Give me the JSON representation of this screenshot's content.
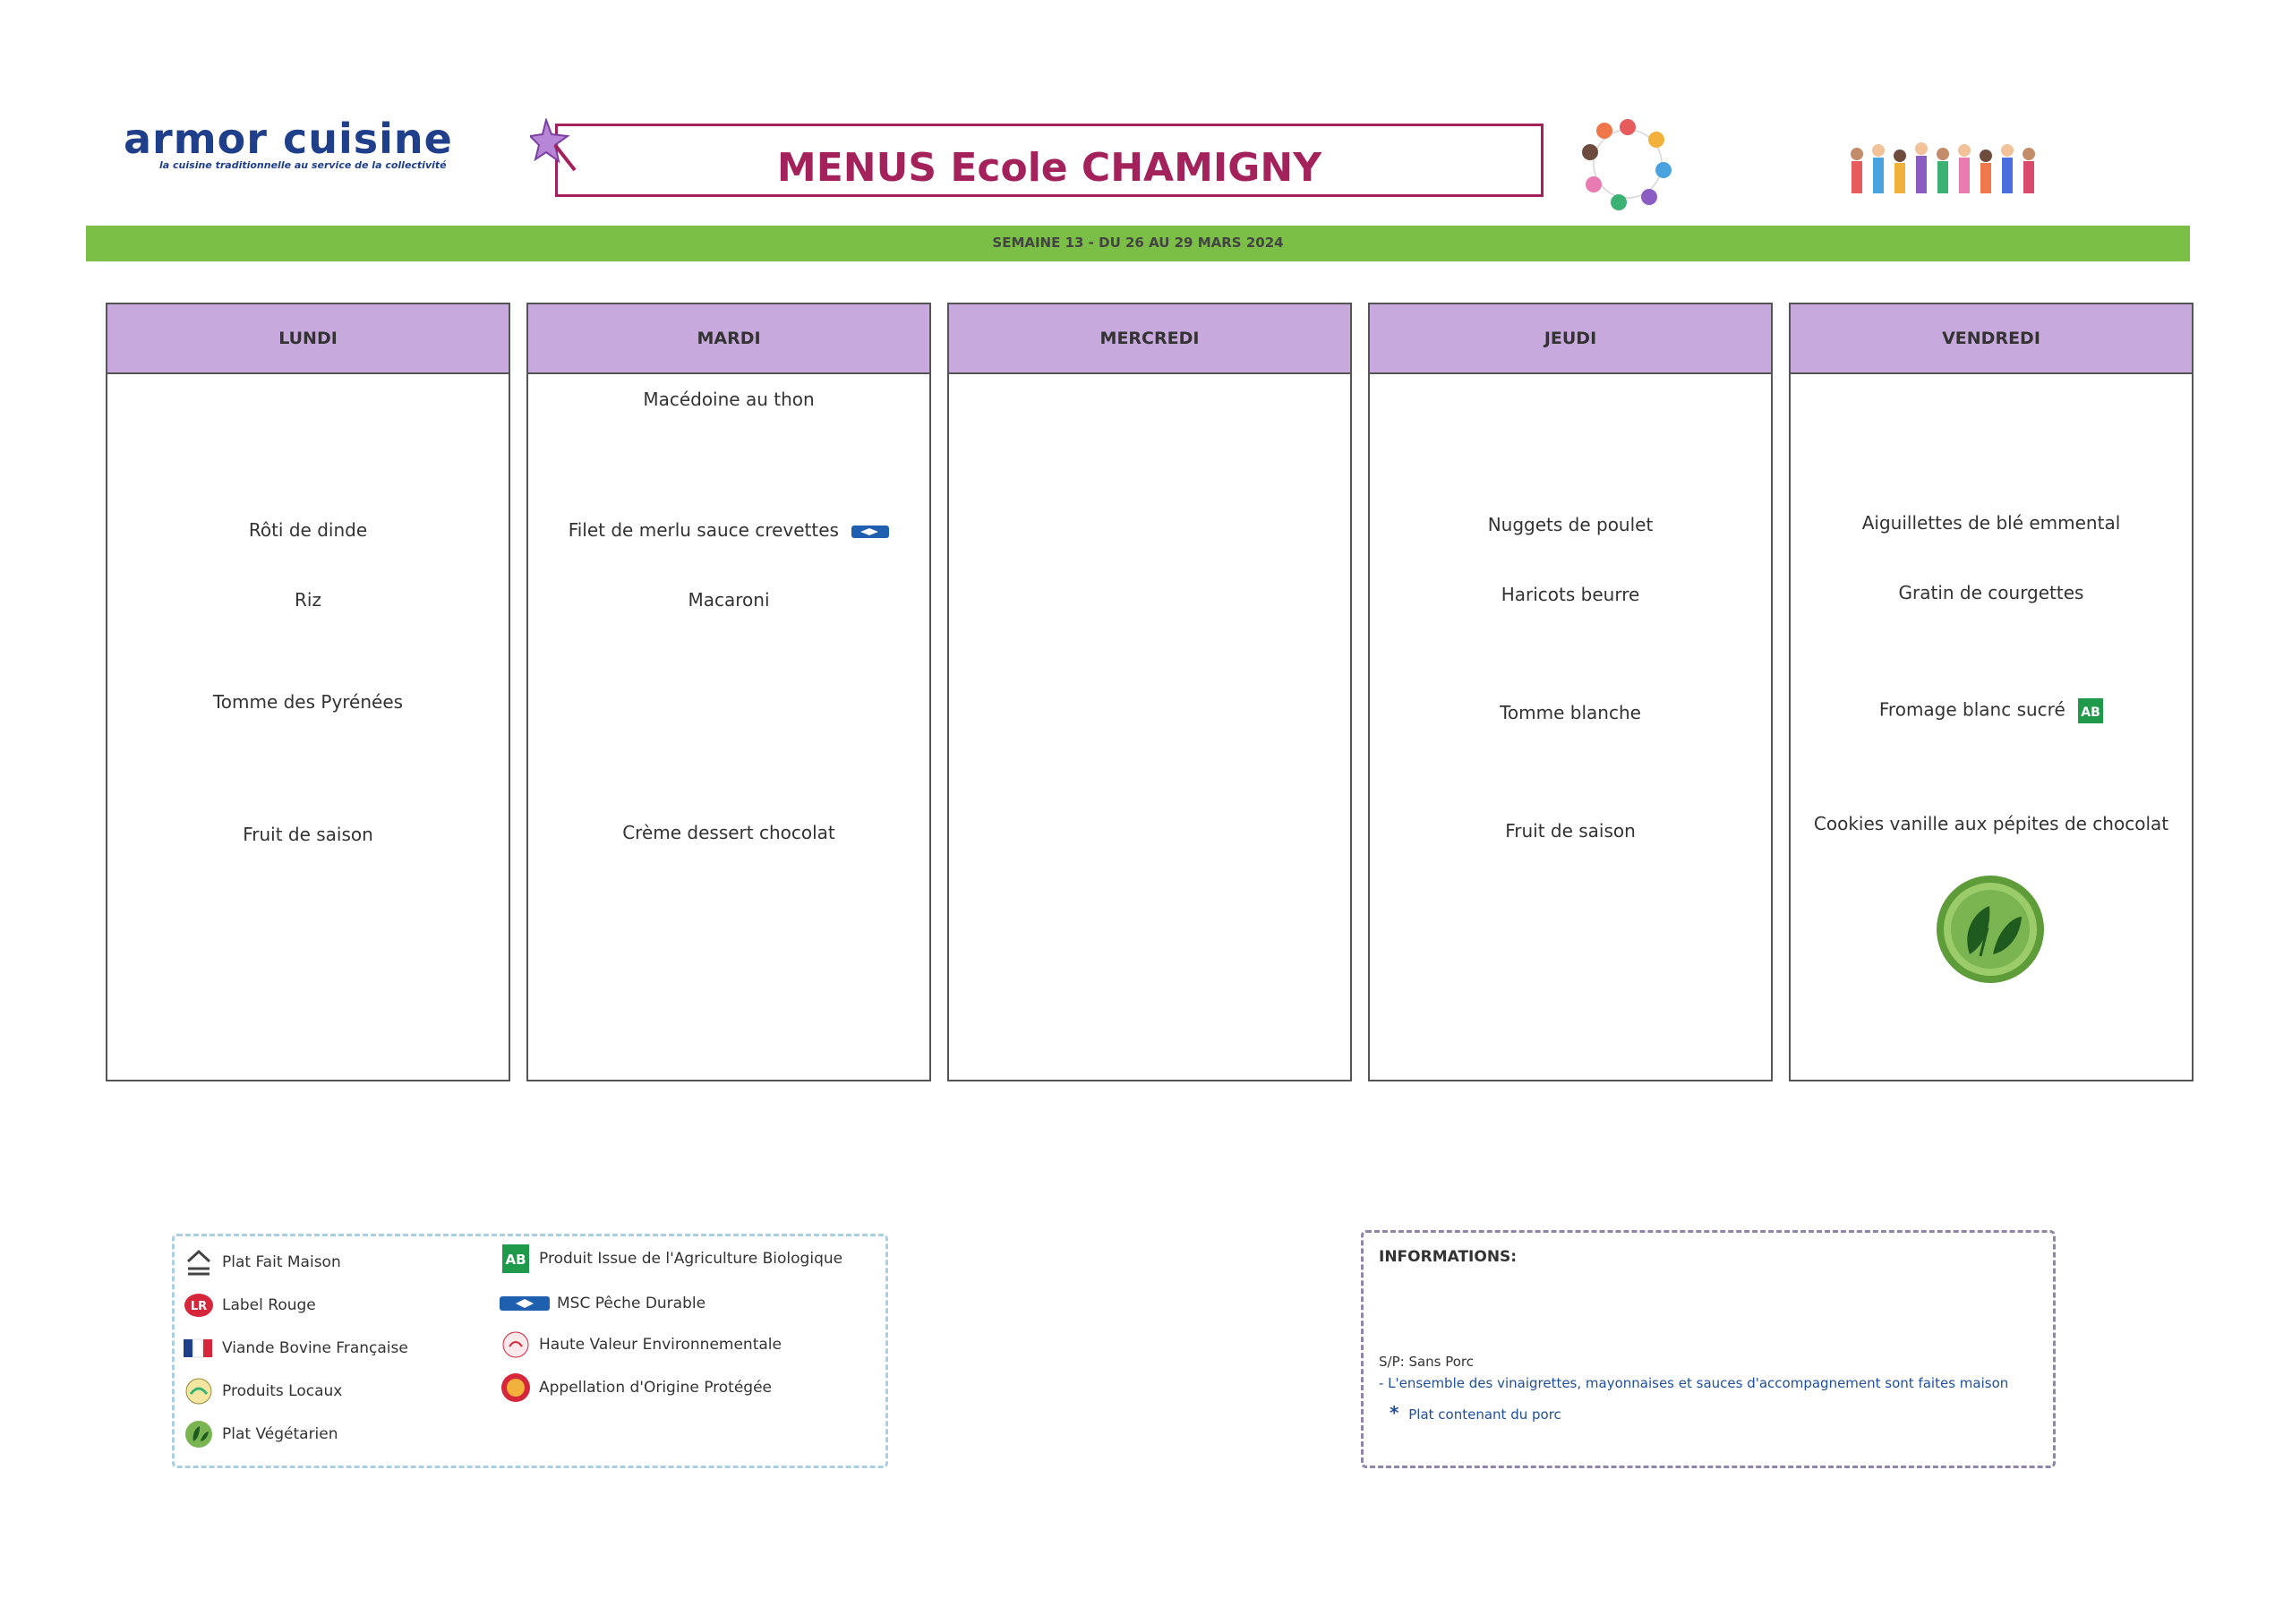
{
  "header": {
    "logo_text": "armor cuisine",
    "logo_tagline": "la cuisine traditionnelle au service de la collectivité",
    "title": "MENUS Ecole CHAMIGNY",
    "week": "SEMAINE 13 - DU 26 AU 29 MARS 2024"
  },
  "days": [
    {
      "name": "LUNDI",
      "dishes": {
        "starter": "",
        "main": "Rôti de dinde",
        "side": "Riz",
        "cheese": "Tomme des Pyrénées",
        "dessert": "Fruit de saison"
      }
    },
    {
      "name": "MARDI",
      "dishes": {
        "starter": "Macédoine au thon",
        "main": "Filet de merlu sauce crevettes",
        "side": "Macaroni",
        "cheese": "",
        "dessert": "Crème dessert chocolat"
      }
    },
    {
      "name": "MERCREDI",
      "dishes": {
        "starter": "",
        "main": "",
        "side": "",
        "cheese": "",
        "dessert": ""
      }
    },
    {
      "name": "JEUDI",
      "dishes": {
        "starter": "",
        "main": "Nuggets de poulet",
        "side": "Haricots beurre",
        "cheese": "Tomme blanche",
        "dessert": "Fruit de saison"
      }
    },
    {
      "name": "VENDREDI",
      "dishes": {
        "starter": "",
        "main": "Aiguillettes de blé emmental",
        "side": "Gratin de courgettes",
        "cheese": "Fromage blanc sucré",
        "dessert": "Cookies vanille aux pépites de chocolat"
      }
    }
  ],
  "legend": {
    "left": [
      {
        "icon": "house-icon",
        "label": "Plat Fait Maison"
      },
      {
        "icon": "label-rouge-icon",
        "label": "Label Rouge"
      },
      {
        "icon": "vbf-icon",
        "label": "Viande Bovine Française"
      },
      {
        "icon": "local-products-icon",
        "label": "Produits Locaux"
      },
      {
        "icon": "vegetarian-icon",
        "label": "Plat Végétarien"
      }
    ],
    "right": [
      {
        "icon": "ab-organic-icon",
        "label": "Produit Issue de l'Agriculture Biologique"
      },
      {
        "icon": "msc-fish-icon",
        "label": "MSC Pêche Durable"
      },
      {
        "icon": "hve-icon",
        "label": "Haute Valeur Environnementale"
      },
      {
        "icon": "aop-icon",
        "label": "Appellation d'Origine Protégée"
      }
    ]
  },
  "info": {
    "title": "INFORMATIONS:",
    "sp": "S/P: Sans Porc",
    "sauces": "- L'ensemble des vinaigrettes, mayonnaises et sauces d'accompagnement sont faites maison",
    "porc": "Plat contenant du porc",
    "porc_mark": "*"
  },
  "colors": {
    "brand": "#1f3f8a",
    "title": "#a3225c",
    "week_bar": "#7bbf46",
    "day_header": "#c7a9dd",
    "info_text": "#1f4f9a"
  }
}
